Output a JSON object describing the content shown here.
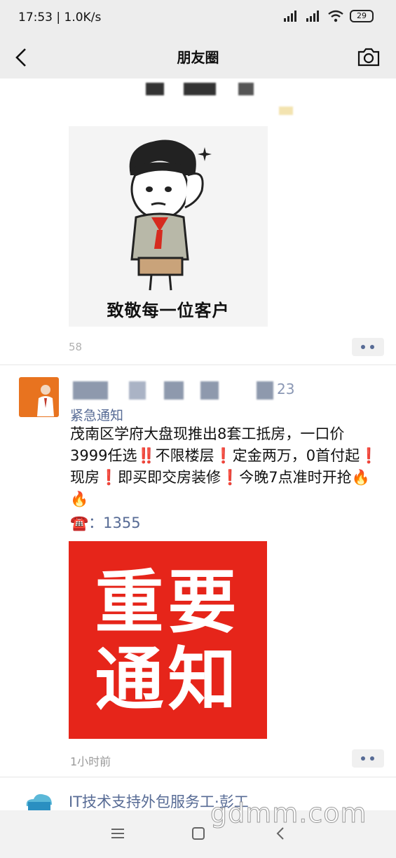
{
  "status_bar": {
    "time": "17:53 | 1.0K/s",
    "battery": "29"
  },
  "nav": {
    "title": "朋友圈"
  },
  "post1": {
    "sticker_caption": "致敬每一位客户",
    "time": "58"
  },
  "post2": {
    "name_suffix": "23",
    "header": "紧急通知",
    "text": "茂南区学府大盘现推出8套工抵房，一口价3999任选‼️不限楼层❗定金两万，0首付起❗现房❗即买即交房装修❗今晚7点准时开抢🔥🔥",
    "phone_icon": "☎️",
    "phone": "：1355",
    "notice_line1": "重要",
    "notice_line2": "通知",
    "time": "1小时前"
  },
  "post3": {
    "name": "IT技术支持外包服务工·彭工"
  },
  "watermark": "gdmm.com",
  "colors": {
    "link": "#576b95",
    "notice_bg": "#e6251a",
    "bar_bg": "#ededed"
  },
  "icons": [
    "back-icon",
    "camera-icon",
    "more-icon",
    "phone-icon",
    "menu-icon",
    "home-icon",
    "system-back-icon"
  ]
}
